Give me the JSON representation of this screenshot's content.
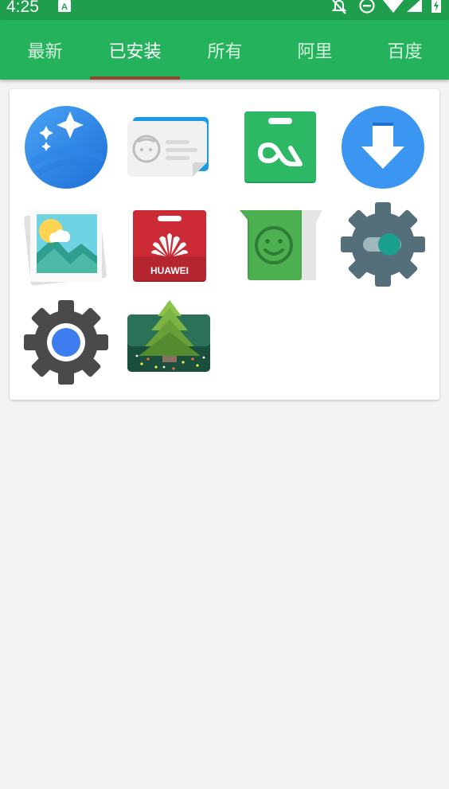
{
  "status_bar": {
    "time": "4:25",
    "icons": [
      "keyboard-a-icon",
      "notifications-off-icon",
      "do-not-disturb-icon",
      "wifi-icon",
      "cellular-signal-icon",
      "battery-charging-icon"
    ]
  },
  "tabs": [
    {
      "label": "最新",
      "active": false
    },
    {
      "label": "已安装",
      "active": true
    },
    {
      "label": "所有",
      "active": false
    },
    {
      "label": "阿里",
      "active": false
    },
    {
      "label": "百度",
      "active": false
    }
  ],
  "apps": [
    {
      "icon": "magic-sparkle-app-icon"
    },
    {
      "icon": "contact-card-app-icon"
    },
    {
      "icon": "app-store-bag-app-icon"
    },
    {
      "icon": "download-arrow-app-icon"
    },
    {
      "icon": "gallery-photos-app-icon"
    },
    {
      "icon": "huawei-store-app-icon"
    },
    {
      "icon": "smiley-sticker-app-icon"
    },
    {
      "icon": "settings-toggle-app-icon"
    },
    {
      "icon": "settings-gear-app-icon"
    },
    {
      "icon": "pine-tree-app-icon"
    }
  ],
  "huawei_label": "HUAWEI",
  "colors": {
    "status_bar": "#1f9e4e",
    "tab_bar": "#24b35c",
    "tab_indicator": "#8b4a2c",
    "background": "#f3f3f3"
  }
}
